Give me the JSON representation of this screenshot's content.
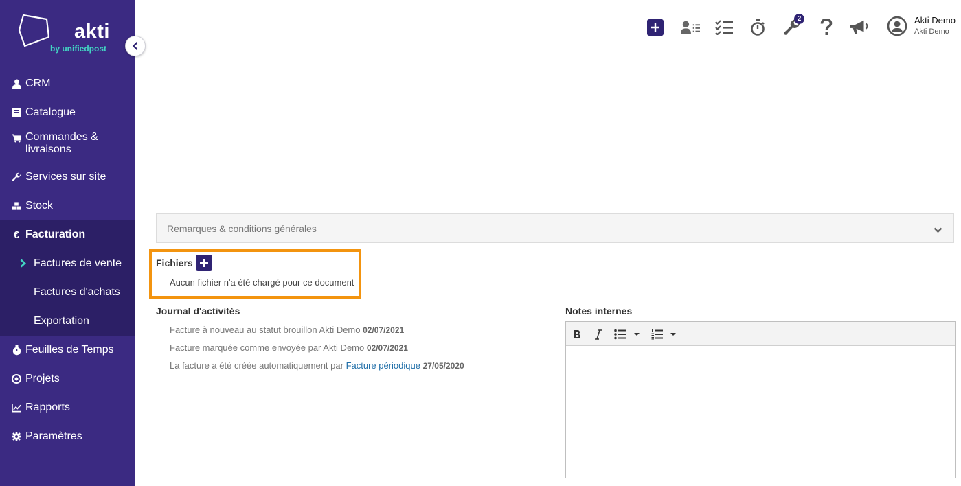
{
  "brand": {
    "name": "akti",
    "tagline": "by unifiedpost"
  },
  "sidebar": {
    "items": [
      {
        "label": "CRM",
        "icon": "user-icon"
      },
      {
        "label": "Catalogue",
        "icon": "book-icon"
      },
      {
        "label": "Commandes & livraisons",
        "icon": "cart-icon"
      },
      {
        "label": "Services sur site",
        "icon": "wrench-icon"
      },
      {
        "label": "Stock",
        "icon": "cubes-icon"
      },
      {
        "label": "Facturation",
        "icon": "euro-icon",
        "active": true
      },
      {
        "label": "Feuilles de Temps",
        "icon": "stopwatch-icon"
      },
      {
        "label": "Projets",
        "icon": "target-icon"
      },
      {
        "label": "Rapports",
        "icon": "line-chart-icon"
      },
      {
        "label": "Paramètres",
        "icon": "gear-icon"
      }
    ],
    "subitems": [
      {
        "label": "Factures de vente",
        "active": true
      },
      {
        "label": "Factures d'achats"
      },
      {
        "label": "Exportation"
      }
    ]
  },
  "topbar": {
    "notifications_count": "2",
    "user": {
      "name": "Akti Demo",
      "org": "Akti Demo"
    }
  },
  "remarks": {
    "label": "Remarques & conditions générales"
  },
  "files": {
    "title": "Fichiers",
    "empty_text": "Aucun fichier n'a été chargé pour ce document"
  },
  "journal": {
    "title": "Journal d'activités",
    "entries": [
      {
        "text": "Facture à nouveau au statut brouillon Akti Demo",
        "date": "02/07/2021"
      },
      {
        "text": "Facture marquée comme envoyée par Akti Demo",
        "date": "02/07/2021"
      },
      {
        "text": "La facture a été créée automatiquement par",
        "link": "Facture périodique",
        "date": "27/05/2020"
      }
    ]
  },
  "notes": {
    "title": "Notes internes"
  },
  "colors": {
    "sidebar": "#3b2a82",
    "sidebar_active": "#2c1f66",
    "accent_teal": "#42d3c2",
    "button": "#2f2373",
    "highlight": "#f3940f",
    "link": "#1f6ea8"
  }
}
